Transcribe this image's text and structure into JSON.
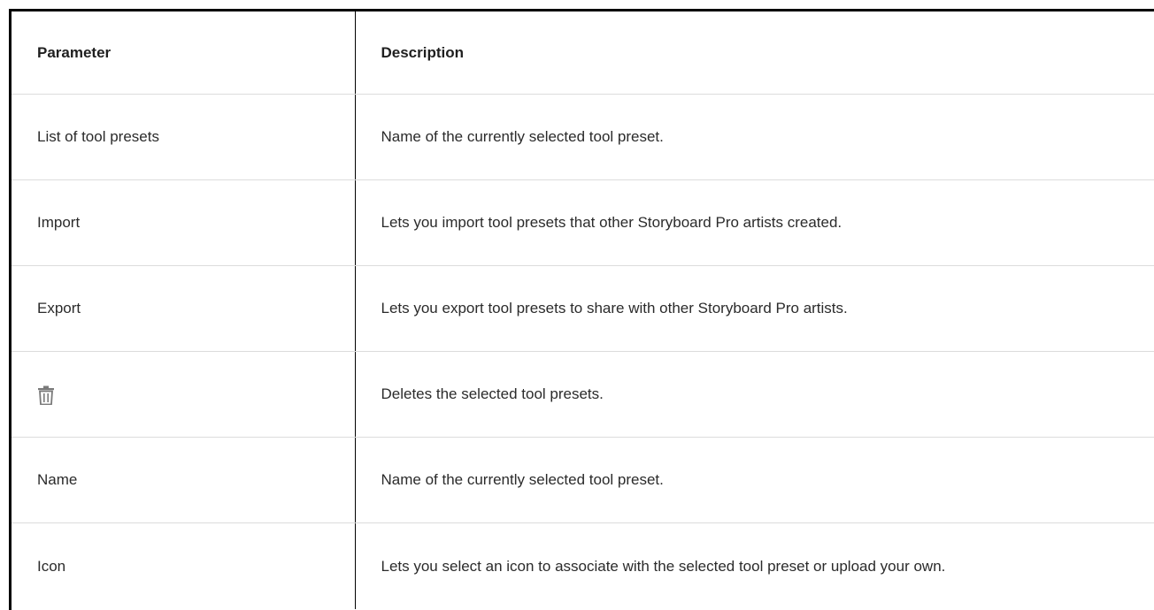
{
  "table": {
    "headers": {
      "parameter": "Parameter",
      "description": "Description"
    },
    "rows": [
      {
        "parameter": "List of tool presets",
        "description": "Name of the currently selected tool preset."
      },
      {
        "parameter": "Import",
        "description": "Lets you import tool presets that other Storyboard Pro artists created."
      },
      {
        "parameter": "Export",
        "description": "Lets you export tool presets to share with other Storyboard Pro artists."
      },
      {
        "parameter_icon": "trash-icon",
        "description": "Deletes the selected tool presets."
      },
      {
        "parameter": "Name",
        "description": "Name of the currently selected tool preset."
      },
      {
        "parameter": "Icon",
        "description": "Lets you select an icon to associate with the selected tool preset or upload your own."
      }
    ]
  },
  "colors": {
    "border": "#000000",
    "row_divider": "#dcdcdc",
    "icon": "#7a7a7a"
  }
}
